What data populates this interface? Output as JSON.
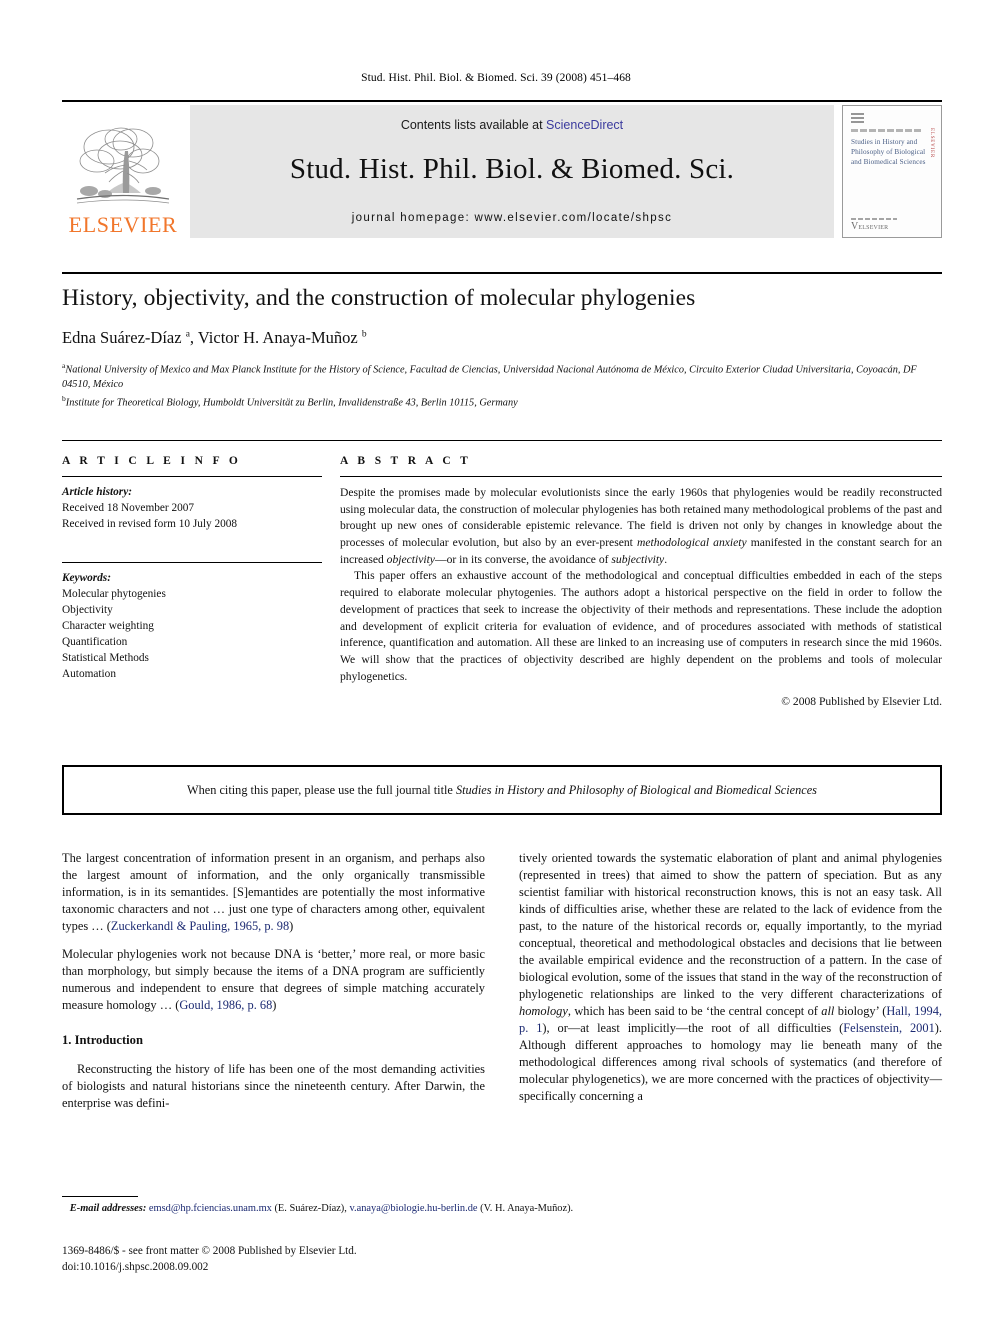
{
  "running_head": "Stud. Hist. Phil. Biol. & Biomed. Sci. 39 (2008) 451–468",
  "masthead": {
    "publisher_name": "ELSEVIER",
    "publisher_logo_alt": "elsevier-tree-logo",
    "contents_prefix": "Contents lists available at ",
    "contents_link": "ScienceDirect",
    "journal_title": "Stud. Hist. Phil. Biol. & Biomed. Sci.",
    "homepage_line": "journal homepage: www.elsevier.com/locate/shpsc",
    "cover": {
      "title": "Studies in History and Philosophy of Biological and Biomedical Sciences",
      "spine_text": "ELSEVIER",
      "imprint": "ELSEVIER"
    }
  },
  "article": {
    "title": "History, objectivity, and the construction of molecular phylogenies",
    "authors_html": "Edna Suárez-Díaz <sup>a</sup>, Victor H. Anaya-Muñoz <sup>b</sup>",
    "affiliation_a": "National University of Mexico and Max Planck Institute for the History of Science, Facultad de Ciencias, Universidad Nacional Autónoma de México, Circuito Exterior Ciudad Universitaria, Coyoacán, DF 04510, México",
    "affiliation_b": "Institute for Theoretical Biology, Humboldt Universität zu Berlin, Invalidenstraße 43, Berlin 10115, Germany",
    "marker_a": "a",
    "marker_b": "b"
  },
  "info": {
    "heading": "A R T I C L E    I N F O",
    "history_label": "Article history:",
    "history_lines": [
      "Received 18 November 2007",
      "Received in revised form 10 July 2008"
    ],
    "keywords_label": "Keywords:",
    "keywords": [
      "Molecular phytogenies",
      "Objectivity",
      "Character weighting",
      "Quantification",
      "Statistical Methods",
      "Automation"
    ]
  },
  "abstract": {
    "heading": "A B S T R A C T",
    "para1_a": "Despite the promises made by molecular evolutionists since the early 1960s that phylogenies would be readily reconstructed using molecular data, the construction of molecular phylogenies has both retained many methodological problems of the past and brought up new ones of considerable epistemic relevance. The field is driven not only by changes in knowledge about the processes of molecular evolution, but also by an ever-present ",
    "para1_em1": "methodological anxiety",
    "para1_b": " manifested in the constant search for an increased ",
    "para1_em2": "objectivity",
    "para1_c": "—or in its converse, the avoidance of ",
    "para1_em3": "subjectivity",
    "para1_d": ".",
    "para2": "This paper offers an exhaustive account of the methodological and conceptual difficulties embedded in each of the steps required to elaborate molecular phytogenies. The authors adopt a historical perspective on the field in order to follow the development of practices that seek to increase the objectivity of their methods and representations. These include the adoption and development of explicit criteria for evaluation of evidence, and of procedures associated with methods of statistical inference, quantification and automation. All these are linked to an increasing use of computers in research since the mid 1960s. We will show that the practices of objectivity described are highly dependent on the problems and tools of molecular phylogenetics.",
    "copyright": "© 2008 Published by Elsevier Ltd."
  },
  "cite_notice": {
    "prefix": "When citing this paper, please use the full journal title ",
    "journal": "Studies in History and Philosophy of Biological and Biomedical Sciences"
  },
  "body": {
    "left": {
      "quote1_a": "The largest concentration of information present in an organism, and perhaps also the largest amount of information, and the only organically transmissible information, is in its semantides. [S]emantides are potentially the most informative taxonomic characters and not … just one type of characters among other, equivalent types … (",
      "quote1_ref": "Zuckerkandl & Pauling, 1965, p. 98",
      "quote1_b": ")",
      "quote2_a": "Molecular phylogenies work not because DNA is ‘better,’ more real, or more basic than morphology, but simply because the items of a DNA program are sufficiently numerous and independent to ensure that degrees of simple matching accurately measure homology … (",
      "quote2_ref": "Gould, 1986, p. 68",
      "quote2_b": ")",
      "section_heading": "1.  Introduction",
      "para1": "Reconstructing the history of life has been one of the most demanding activities of biologists and natural historians since the nineteenth century. After Darwin, the enterprise was defini-"
    },
    "right": {
      "para_a": "tively oriented towards the systematic elaboration of plant and animal phylogenies (represented in trees) that aimed to show the pattern of speciation. But as any scientist familiar with historical reconstruction knows, this is not an easy task. All kinds of difficulties arise, whether these are related to the lack of evidence from the past, to the nature of the historical records or, equally importantly, to the myriad conceptual, theoretical and methodological obstacles and decisions that lie between the available empirical evidence and the reconstruction of a pattern. In the case of biological evolution, some of the issues that stand in the way of the reconstruction of phylogenetic relationships are linked to the very different characterizations of ",
      "em_homology": "homology",
      "para_b": ", which has been said to be ‘the central concept of ",
      "em_all": "all",
      "para_c": " biology’ (",
      "ref_hall": "Hall, 1994, p. 1",
      "para_d": "), or—at least implicitly—the root of all difficulties (",
      "ref_felsenstein": "Felsenstein, 2001",
      "para_e": "). Although different approaches to homology may lie beneath many of the methodological differences among rival schools of systematics (and therefore of molecular phylogenetics), we are more concerned with the practices of objectivity—specifically concerning a"
    }
  },
  "footer": {
    "email_label": "E-mail addresses:",
    "email1": "emsd@hp.fciencias.unam.mx",
    "email1_author": " (E. Suárez-Díaz), ",
    "email2": "v.anaya@biologie.hu-berlin.de",
    "email2_author": " (V. H. Anaya-Muñoz).",
    "imprint_line1": "1369-8486/$ - see front matter © 2008 Published by Elsevier Ltd.",
    "imprint_line2": "doi:10.1016/j.shpsc.2008.09.002"
  },
  "colors": {
    "elsevier_orange": "#F1762B",
    "link_blue": "#1c2a72",
    "sciencedirect_blue": "#3b3b9e",
    "band_gray": "#e6e6e6"
  }
}
